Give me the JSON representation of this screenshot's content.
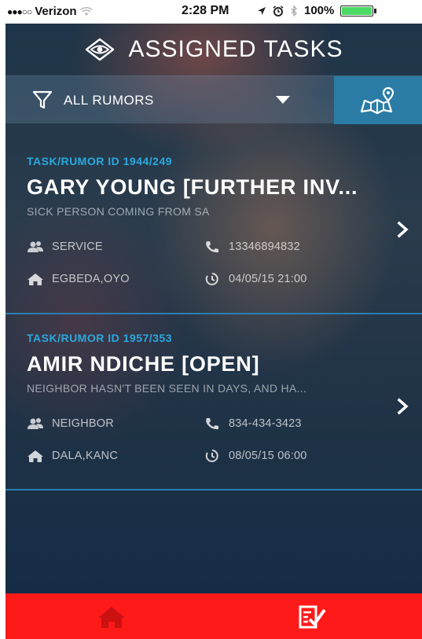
{
  "status_bar": {
    "signal_dots": "●●●○○",
    "carrier": "Verizon",
    "time": "2:28 PM",
    "battery_percent": "100%"
  },
  "header": {
    "title": "ASSIGNED TASKS",
    "logo_icon": "eye-logo-icon"
  },
  "filter": {
    "selected": "ALL RUMORS",
    "filter_icon": "funnel-icon",
    "map_icon": "map-pin-icon"
  },
  "tasks": [
    {
      "id_label": "TASK/RUMOR ID 1944/249",
      "title": "GARY YOUNG [FURTHER INV...",
      "description": "SICK PERSON COMING FROM SA",
      "type": "SERVICE",
      "phone": "13346894832",
      "location": "EGBEDA,OYO",
      "datetime": "04/05/15 21:00"
    },
    {
      "id_label": "TASK/RUMOR ID 1957/353",
      "title": "AMIR NDICHE [OPEN]",
      "description": "NEIGHBOR HASN'T BEEN SEEN IN DAYS, AND HA...",
      "type": "NEIGHBOR",
      "phone": "834-434-3423",
      "location": "DALA,KANC",
      "datetime": "08/05/15 06:00"
    }
  ],
  "tabbar": {
    "home_icon": "home-icon",
    "tasks_icon": "task-checklist-icon",
    "background": "#ff1a1a",
    "inactive_icon_color": "#cc1111",
    "active_icon_color": "#ffffff"
  },
  "colors": {
    "accent": "#29a9e0",
    "map_button": "#2a7ca6",
    "divider": "#2b7fb0"
  }
}
